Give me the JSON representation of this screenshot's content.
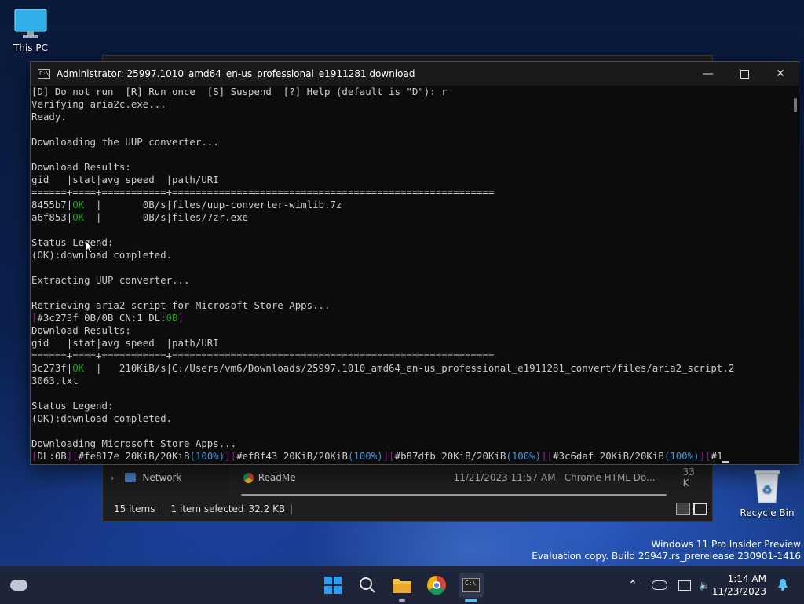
{
  "desktop": {
    "this_pc_label": "This PC",
    "recycle_bin_label": "Recycle Bin"
  },
  "explorer": {
    "nav_item": "Network",
    "file_name": "ReadMe",
    "file_date": "11/21/2023 11:57 AM",
    "file_type": "Chrome HTML Do...",
    "file_size": "33 K",
    "status_items": "15 items",
    "status_selected": "1 item selected",
    "status_size": "32.2 KB"
  },
  "console": {
    "title": "Administrator:  25997.1010_amd64_en-us_professional_e1911281 download",
    "lines": [
      "[D] Do not run  [R] Run once  [S] Suspend  [?] Help (default is \"D\"): r",
      "Verifying aria2c.exe...",
      "Ready.",
      "",
      "Downloading the UUP converter...",
      "",
      "Download Results:",
      "gid   |stat|avg speed  |path/URI",
      "======+====+===========+=======================================================",
      "8455b7|OK  |       0B/s|files/uup-converter-wimlib.7z",
      "a6f853|OK  |       0B/s|files/7zr.exe",
      "",
      "Status Legend:",
      "(OK):download completed.",
      "",
      "Extracting UUP converter...",
      "",
      "Retrieving aria2 script for Microsoft Store Apps...",
      "[#3c273f 0B/0B CN:1 DL:0B]",
      "Download Results:",
      "gid   |stat|avg speed  |path/URI",
      "======+====+===========+=======================================================",
      "3c273f|OK  |   210KiB/s|C:/Users/vm6/Downloads/25997.1010_amd64_en-us_professional_e1911281_convert/files/aria2_script.2",
      "3063.txt",
      "",
      "Status Legend:",
      "(OK):download completed.",
      "",
      "Downloading Microsoft Store Apps...",
      "[DL:0B][#fe817e 20KiB/20KiB(100%)][#ef8f43 20KiB/20KiB(100%)][#b87dfb 20KiB/20KiB(100%)][#3c6daf 20KiB/20KiB(100%)][#1"
    ],
    "colors": {
      "text": "#cccccc",
      "green": "#13a10e",
      "cyan": "#3a96dd",
      "magenta": "#881798"
    }
  },
  "watermark": {
    "line1": "Windows 11 Pro Insider Preview",
    "line2": "Evaluation copy. Build 25947.rs_prerelease.230901-1416"
  },
  "taskbar": {
    "time": "1:14 AM",
    "date": "11/23/2023",
    "apps": [
      "start-icon",
      "search-icon",
      "file-explorer-icon",
      "chrome-icon",
      "terminal-icon"
    ]
  }
}
